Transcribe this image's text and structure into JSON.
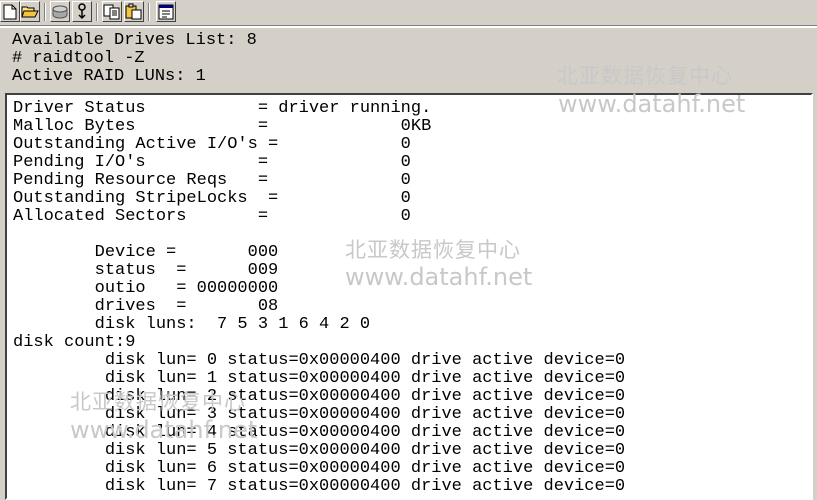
{
  "toolbar": {
    "buttons": [
      {
        "icon": "new-file-icon"
      },
      {
        "icon": "open-folder-icon"
      },
      {
        "icon": "disk-icon"
      },
      {
        "icon": "tool-icon"
      },
      {
        "icon": "copy-icon"
      },
      {
        "icon": "paste-icon"
      },
      {
        "icon": "properties-icon"
      }
    ]
  },
  "header": {
    "line1": "Available Drives List: 8",
    "line2": "# raidtool -Z",
    "line3": "Active RAID LUNs: 1"
  },
  "watermark": {
    "cn": "北亚数据恢复中心",
    "url": "www.datahf.net"
  },
  "output": {
    "lines": [
      "Driver Status           = driver running.",
      "Malloc Bytes            =             0KB",
      "Outstanding Active I/O's =            0",
      "Pending I/O's           =             0",
      "Pending Resource Reqs   =             0",
      "Outstanding StripeLocks  =            0",
      "Allocated Sectors       =             0",
      "",
      "        Device =       000",
      "        status  =      009",
      "        outio   = 00000000",
      "        drives  =       08",
      "        disk luns:  7 5 3 1 6 4 2 0",
      "disk count:9",
      "         disk lun= 0 status=0x00000400 drive active device=0",
      "         disk lun= 1 status=0x00000400 drive active device=0",
      "         disk lun= 2 status=0x00000400 drive active device=0",
      "         disk lun= 3 status=0x00000400 drive active device=0",
      "         disk lun= 4 status=0x00000400 drive active device=0",
      "         disk lun= 5 status=0x00000400 drive active device=0",
      "         disk lun= 6 status=0x00000400 drive active device=0",
      "         disk lun= 7 status=0x00000400 drive active device=0"
    ]
  },
  "colors": {
    "chrome": "#d4d0c8",
    "terminal_bg": "#ffffff",
    "text": "#000000",
    "watermark": "#c8c8c8"
  }
}
